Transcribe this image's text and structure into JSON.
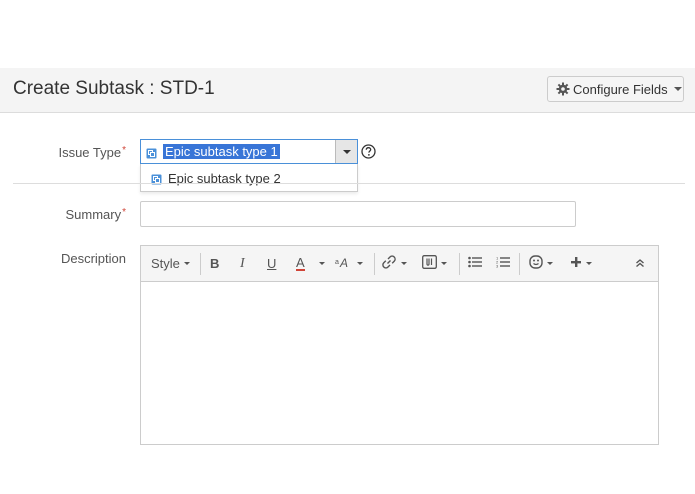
{
  "header": {
    "title": "Create Subtask : STD-1",
    "configure_label": "Configure Fields",
    "configure_icon": "gear-icon"
  },
  "fields": {
    "issue_type": {
      "label": "Issue Type",
      "required_marker": "*",
      "selected_value": "Epic subtask type 1",
      "options": [
        "Epic subtask type 2"
      ],
      "help_icon": "question-circle-icon"
    },
    "summary": {
      "label": "Summary",
      "required_marker": "*",
      "value": ""
    },
    "description": {
      "label": "Description",
      "toolbar": {
        "style_label": "Style",
        "bold": "B",
        "italic": "I",
        "underline": "U",
        "text_color": "A",
        "icons": [
          "text-size-icon",
          "link-icon",
          "attachment-icon",
          "bullet-list-icon",
          "numbered-list-icon",
          "emoticon-icon",
          "plus-icon",
          "collapse-icon"
        ]
      }
    }
  },
  "colors": {
    "accent": "#3875d7",
    "required": "#d04437",
    "header_bg": "#f4f4f4",
    "text_color_underline": "#d04437"
  }
}
